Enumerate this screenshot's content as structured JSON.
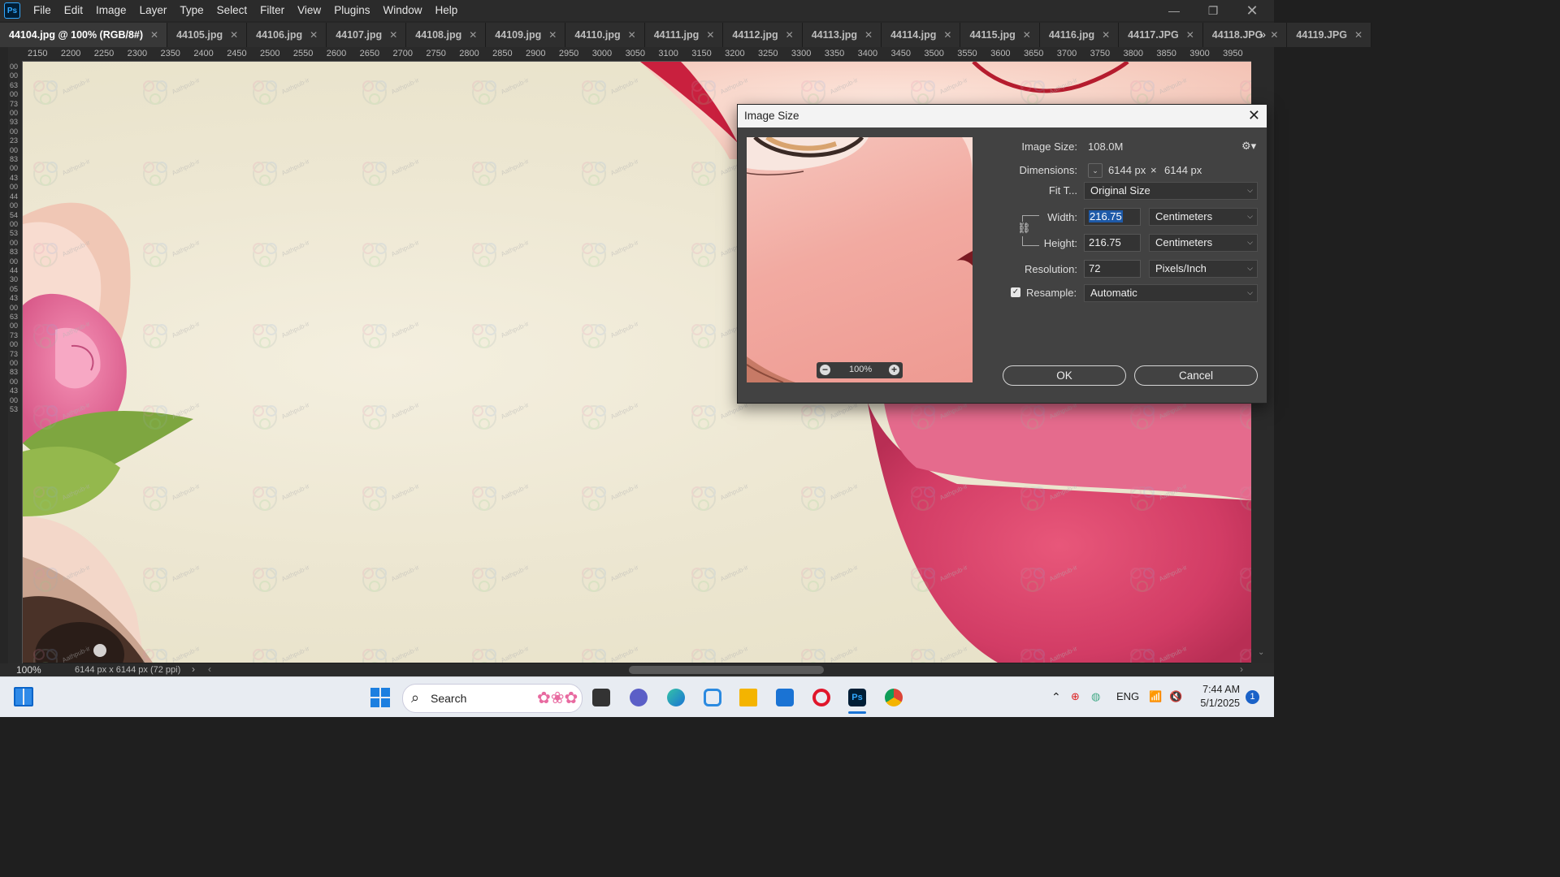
{
  "app": {
    "logo": "Ps",
    "menu": [
      "File",
      "Edit",
      "Image",
      "Layer",
      "Type",
      "Select",
      "Filter",
      "View",
      "Plugins",
      "Window",
      "Help"
    ]
  },
  "tabs": [
    {
      "label": "44104.jpg @ 100% (RGB/8#)",
      "active": true
    },
    {
      "label": "44105.jpg"
    },
    {
      "label": "44106.jpg"
    },
    {
      "label": "44107.jpg"
    },
    {
      "label": "44108.jpg"
    },
    {
      "label": "44109.jpg"
    },
    {
      "label": "44110.jpg"
    },
    {
      "label": "44111.jpg"
    },
    {
      "label": "44112.jpg"
    },
    {
      "label": "44113.jpg"
    },
    {
      "label": "44114.jpg"
    },
    {
      "label": "44115.jpg"
    },
    {
      "label": "44116.jpg"
    },
    {
      "label": "44117.JPG"
    },
    {
      "label": "44118.JPG"
    },
    {
      "label": "44119.JPG"
    }
  ],
  "ruler": {
    "top_ticks": [
      "2150",
      "2200",
      "2250",
      "2300",
      "2350",
      "2400",
      "2450",
      "2500",
      "2550",
      "2600",
      "2650",
      "2700",
      "2750",
      "2800",
      "2850",
      "2900",
      "2950",
      "3000",
      "3050",
      "3100",
      "3150",
      "3200",
      "3250",
      "3300",
      "3350",
      "3400",
      "3450",
      "3500",
      "3550",
      "3600",
      "3650",
      "3700",
      "3750",
      "3800",
      "3850",
      "3900",
      "3950"
    ],
    "left_digits": "0000630073009300230083004300440054005300830044300543006300730073008300430053"
  },
  "status": {
    "zoom": "100%",
    "doc_info": "6144 px x 6144 px (72 ppi)"
  },
  "dialog": {
    "title": "Image Size",
    "preview_zoom": "100%",
    "image_size_label": "Image Size:",
    "image_size_value": "108.0M",
    "dimensions_label": "Dimensions:",
    "dim_w": "6144 px",
    "dim_x": "×",
    "dim_h": "6144 px",
    "fit_label": "Fit T...",
    "fit_value": "Original Size",
    "width_label": "Width:",
    "width_value": "216.75",
    "width_unit": "Centimeters",
    "height_label": "Height:",
    "height_value": "216.75",
    "height_unit": "Centimeters",
    "resolution_label": "Resolution:",
    "resolution_value": "72",
    "resolution_unit": "Pixels/Inch",
    "resample_label": "Resample:",
    "resample_checked": true,
    "resample_value": "Automatic",
    "ok_label": "OK",
    "cancel_label": "Cancel"
  },
  "taskbar": {
    "search_label": "Search",
    "lang": "ENG",
    "time": "7:44 AM",
    "date": "5/1/2025",
    "notification_count": "1"
  }
}
